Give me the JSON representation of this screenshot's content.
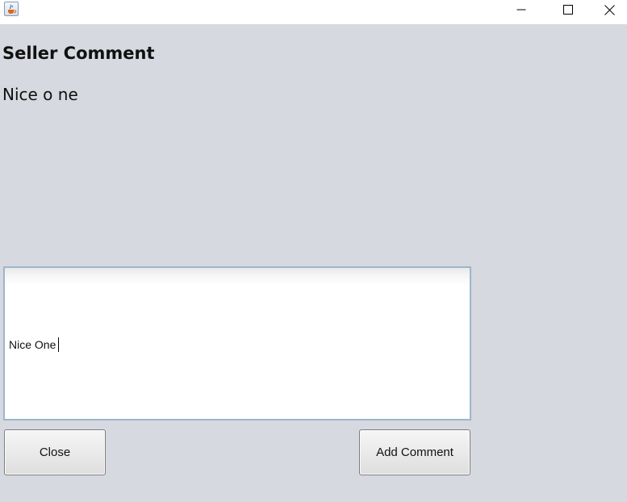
{
  "window": {
    "icon": "java-coffee-cup-icon",
    "controls": {
      "minimize_icon": "minimize-icon",
      "maximize_icon": "maximize-icon",
      "close_icon": "close-icon"
    }
  },
  "content": {
    "heading": "Seller Comment",
    "comment": "Nice o ne"
  },
  "input": {
    "value": "Nice One"
  },
  "buttons": {
    "close_label": "Close",
    "add_comment_label": "Add Comment"
  },
  "colors": {
    "background": "#d6d9e0",
    "input_border": "#9bb6cc",
    "titlebar": "#ffffff"
  }
}
